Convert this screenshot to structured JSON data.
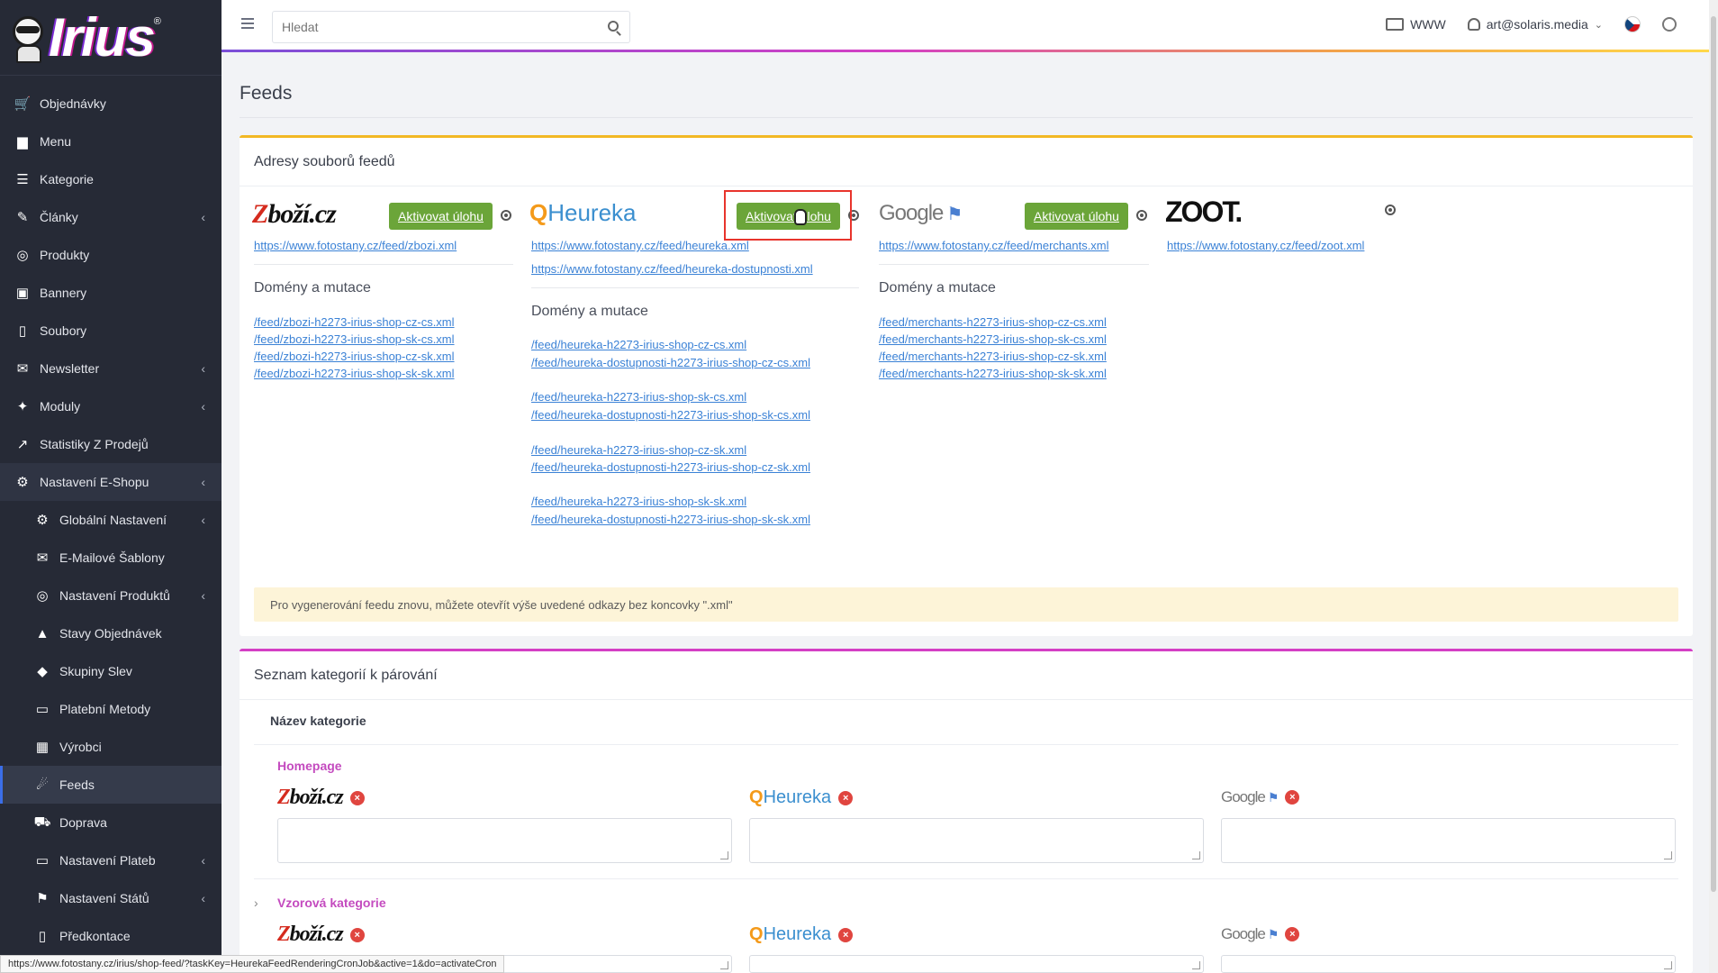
{
  "brand": {
    "logo_text": "Irius",
    "reg": "®"
  },
  "sidebar": {
    "items": [
      {
        "label": "Objednávky",
        "icon": "cart-icon",
        "glyph": "🛒",
        "chevron": false
      },
      {
        "label": "Menu",
        "icon": "folder-icon",
        "glyph": "▆",
        "chevron": false
      },
      {
        "label": "Kategorie",
        "icon": "list-icon",
        "glyph": "☰",
        "chevron": false
      },
      {
        "label": "Články",
        "icon": "pencil-icon",
        "glyph": "✎",
        "chevron": true
      },
      {
        "label": "Produkty",
        "icon": "basketball-icon",
        "glyph": "◎",
        "chevron": false
      },
      {
        "label": "Bannery",
        "icon": "image-icon",
        "glyph": "▣",
        "chevron": false
      },
      {
        "label": "Soubory",
        "icon": "file-icon",
        "glyph": "▯",
        "chevron": false
      },
      {
        "label": "Newsletter",
        "icon": "mail-circle-icon",
        "glyph": "✉",
        "chevron": true
      },
      {
        "label": "Moduly",
        "icon": "puzzle-icon",
        "glyph": "✦",
        "chevron": true
      },
      {
        "label": "Statistiky Z Prodejů",
        "icon": "chart-line-icon",
        "glyph": "↗",
        "chevron": false
      },
      {
        "label": "Nastavení E-Shopu",
        "icon": "cogs-icon",
        "glyph": "⚙",
        "chevron": true,
        "section": true
      }
    ],
    "subitems": [
      {
        "label": "Globální Nastavení",
        "icon": "gear-icon",
        "glyph": "⚙",
        "chevron": true
      },
      {
        "label": "E-Mailové Šablony",
        "icon": "envelope-icon",
        "glyph": "✉",
        "chevron": false
      },
      {
        "label": "Nastavení Produktů",
        "icon": "basketball-icon",
        "glyph": "◎",
        "chevron": true
      },
      {
        "label": "Stavy Objednávek",
        "icon": "bell-icon",
        "glyph": "▲",
        "chevron": false
      },
      {
        "label": "Skupiny Slev",
        "icon": "tag-icon",
        "glyph": "◆",
        "chevron": false
      },
      {
        "label": "Platební Metody",
        "icon": "card-icon",
        "glyph": "▭",
        "chevron": false
      },
      {
        "label": "Výrobci",
        "icon": "building-icon",
        "glyph": "▦",
        "chevron": false
      },
      {
        "label": "Feeds",
        "icon": "feed-icon",
        "glyph": "☄",
        "chevron": false,
        "active": true
      },
      {
        "label": "Doprava",
        "icon": "truck-icon",
        "glyph": "⛟",
        "chevron": false
      },
      {
        "label": "Nastavení Plateb",
        "icon": "card-icon",
        "glyph": "▭",
        "chevron": true
      },
      {
        "label": "Nastavení Států",
        "icon": "flag-icon",
        "glyph": "⚑",
        "chevron": true
      },
      {
        "label": "Předkontace",
        "icon": "file-icon",
        "glyph": "▯",
        "chevron": false
      }
    ]
  },
  "topbar": {
    "search_placeholder": "Hledat",
    "www_label": "WWW",
    "user_email": "art@solaris.media"
  },
  "page": {
    "title": "Feeds"
  },
  "feeds_card": {
    "title": "Adresy souborů feedů",
    "activate_label": "Aktivovat úlohu",
    "domains_title": "Domény a mutace",
    "zbozi": {
      "brand_a": "Z",
      "brand_b": "boží.cz",
      "main_url": "https://www.fotostany.cz/feed/zbozi.xml",
      "domains": [
        "/feed/zbozi-h2273-irius-shop-cz-cs.xml",
        "/feed/zbozi-h2273-irius-shop-sk-cs.xml",
        "/feed/zbozi-h2273-irius-shop-cz-sk.xml",
        "/feed/zbozi-h2273-irius-shop-sk-sk.xml"
      ]
    },
    "heureka": {
      "brand_q": "Q",
      "brand_text": "Heureka",
      "main_url": "https://www.fotostany.cz/feed/heureka.xml",
      "availability_url": "https://www.fotostany.cz/feed/heureka-dostupnosti.xml",
      "domains": [
        "/feed/heureka-h2273-irius-shop-cz-cs.xml",
        "/feed/heureka-dostupnosti-h2273-irius-shop-cz-cs.xml",
        "/feed/heureka-h2273-irius-shop-sk-cs.xml",
        "/feed/heureka-dostupnosti-h2273-irius-shop-sk-cs.xml",
        "/feed/heureka-h2273-irius-shop-cz-sk.xml",
        "/feed/heureka-dostupnosti-h2273-irius-shop-cz-sk.xml",
        "/feed/heureka-h2273-irius-shop-sk-sk.xml",
        "/feed/heureka-dostupnosti-h2273-irius-shop-sk-sk.xml"
      ]
    },
    "google": {
      "brand_text": "Google",
      "main_url": "https://www.fotostany.cz/feed/merchants.xml",
      "domains": [
        "/feed/merchants-h2273-irius-shop-cz-cs.xml",
        "/feed/merchants-h2273-irius-shop-sk-cs.xml",
        "/feed/merchants-h2273-irius-shop-cz-sk.xml",
        "/feed/merchants-h2273-irius-shop-sk-sk.xml"
      ]
    },
    "zoot": {
      "brand_text": "ZOOT.",
      "main_url": "https://www.fotostany.cz/feed/zoot.xml"
    },
    "notice": "Pro vygenerování feedu znovu, můžete otevřít výše uvedené odkazy bez koncovky \".xml\""
  },
  "categories_card": {
    "title": "Seznam kategorií k párování",
    "column_header": "Název kategorie",
    "rows": [
      {
        "label": "Homepage"
      },
      {
        "label": "Vzorová kategorie"
      }
    ],
    "brand_heureka": "Heureka",
    "brand_google": "Google",
    "remove_glyph": "×"
  },
  "status_bar": {
    "url": "https://www.fotostany.cz/irius/shop-feed/?taskKey=HeurekaFeedRenderingCronJob&active=1&do=activateCron"
  }
}
